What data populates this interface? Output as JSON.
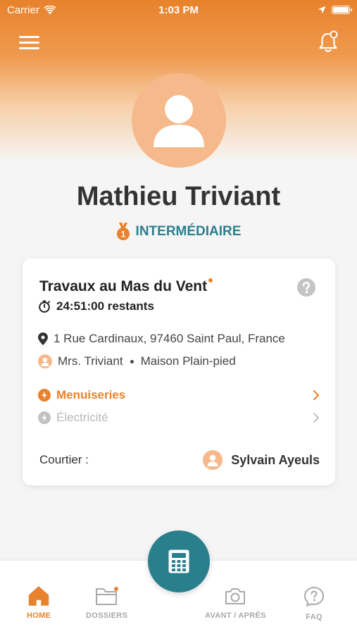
{
  "status_bar": {
    "carrier": "Carrier",
    "time": "1:03 PM"
  },
  "header": {
    "menu_icon": "hamburger-icon",
    "notification_icon": "bell-icon"
  },
  "profile": {
    "name": "Mathieu Triviant",
    "level_badge_icon": "medal-icon",
    "level_badge_number": "1",
    "level": "INTERMÉDIAIRE"
  },
  "project_card": {
    "title": "Travaux au Mas du Vent",
    "remaining": "24:51:00 restants",
    "address": "1 Rue Cardinaux, 97460 Saint Paul, France",
    "client": "Mrs. Triviant",
    "property_type": "Maison Plain-pied",
    "trades": [
      {
        "label": "Menuiseries",
        "active": true
      },
      {
        "label": "Électricité",
        "active": false
      }
    ],
    "broker_label": "Courtier :",
    "broker_name": "Sylvain Ayeuls"
  },
  "tabbar": {
    "tabs": [
      {
        "label": "HOME",
        "icon": "home-icon",
        "active": true
      },
      {
        "label": "DOSSIERS",
        "icon": "folder-icon",
        "active": false
      },
      {
        "label": "AVANT / APRÈS",
        "icon": "camera-icon",
        "active": false
      },
      {
        "label": "FAQ",
        "icon": "question-icon",
        "active": false
      }
    ],
    "fab_icon": "calculator-icon"
  },
  "colors": {
    "accent_orange": "#e8822c",
    "teal": "#2a7f8d",
    "avatar_peach": "#f5b98c",
    "inactive_gray": "#b9b9b9"
  }
}
